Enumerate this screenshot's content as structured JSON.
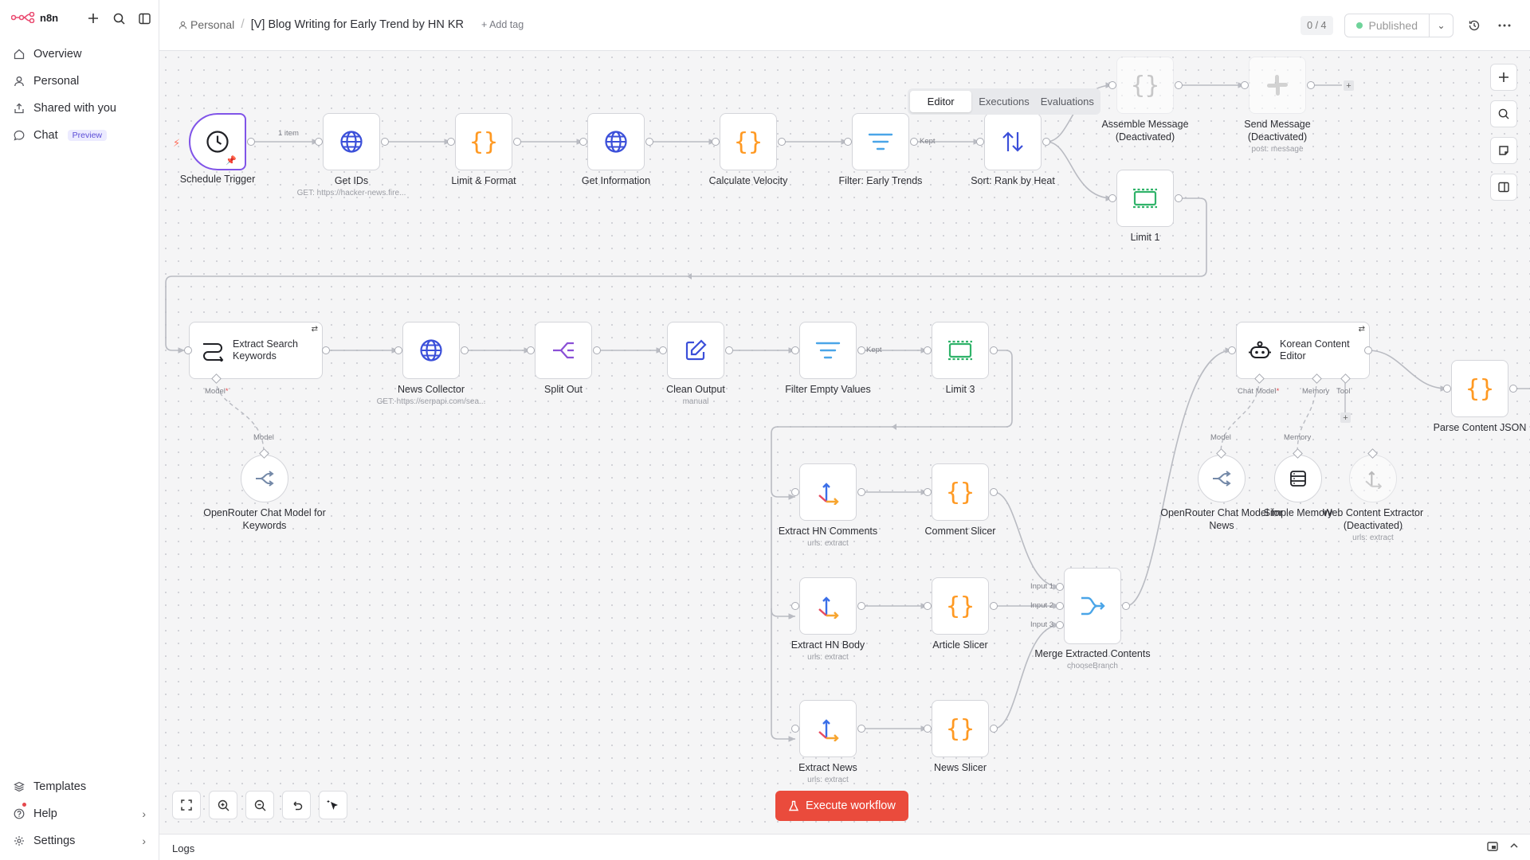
{
  "sidebar": {
    "brand": "n8n",
    "items": [
      {
        "label": "Overview",
        "icon": "home-icon"
      },
      {
        "label": "Personal",
        "icon": "user-icon"
      },
      {
        "label": "Shared with you",
        "icon": "share-icon"
      },
      {
        "label": "Chat",
        "icon": "chat-icon",
        "badge": "Preview"
      }
    ],
    "bottom": [
      {
        "label": "Templates",
        "icon": "templates-icon"
      },
      {
        "label": "Help",
        "icon": "help-icon"
      },
      {
        "label": "Settings",
        "icon": "settings-icon"
      }
    ]
  },
  "header": {
    "breadcrumb_personal": "Personal",
    "workflow_title": "[V] Blog Writing for Early Trend by HN KR",
    "add_tag": "+ Add tag",
    "counter": "0 / 4",
    "publish_status": "Published"
  },
  "tabs": [
    "Editor",
    "Executions",
    "Evaluations"
  ],
  "nodes": {
    "schedule_trigger": {
      "label": "Schedule Trigger"
    },
    "get_ids": {
      "label": "Get IDs",
      "sub": "GET: https://hacker-news.fire..."
    },
    "limit_format": {
      "label": "Limit & Format"
    },
    "get_information": {
      "label": "Get Information"
    },
    "calculate_velocity": {
      "label": "Calculate Velocity"
    },
    "filter_early": {
      "label": "Filter: Early Trends"
    },
    "sort_rank": {
      "label": "Sort: Rank by Heat"
    },
    "assemble_message": {
      "label": "Assemble Message (Deactivated)"
    },
    "send_message": {
      "label": "Send Message (Deactivated)",
      "sub": "post: message"
    },
    "limit_1": {
      "label": "Limit 1"
    },
    "extract_keywords": {
      "label": "Extract Search Keywords"
    },
    "news_collector": {
      "label": "News Collector",
      "sub": "GET: https://serpapi.com/sea..."
    },
    "split_out": {
      "label": "Split Out"
    },
    "clean_output": {
      "label": "Clean Output",
      "sub": "manual"
    },
    "filter_empty": {
      "label": "Filter Empty Values"
    },
    "limit_3": {
      "label": "Limit 3"
    },
    "openrouter_keywords": {
      "label": "OpenRouter Chat Model for Keywords"
    },
    "extract_hn_comments": {
      "label": "Extract HN Comments",
      "sub": "urls: extract"
    },
    "comment_slicer": {
      "label": "Comment Slicer"
    },
    "extract_hn_body": {
      "label": "Extract HN Body",
      "sub": "urls: extract"
    },
    "article_slicer": {
      "label": "Article Slicer"
    },
    "extract_news": {
      "label": "Extract News",
      "sub": "urls: extract"
    },
    "news_slicer": {
      "label": "News Slicer"
    },
    "merge_contents": {
      "label": "Merge Extracted Contents",
      "sub": "chooseBranch"
    },
    "korean_editor": {
      "label": "Korean Content Editor"
    },
    "openrouter_news": {
      "label": "OpenRouter Chat Model for News"
    },
    "simple_memory": {
      "label": "Simple Memory"
    },
    "web_extractor": {
      "label": "Web Content Extractor (Deactivated)",
      "sub": "urls: extract"
    },
    "parse_json": {
      "label": "Parse Content JSON"
    }
  },
  "edge_labels": {
    "one_item": "1 item",
    "kept1": "Kept",
    "kept2": "Kept",
    "model": "Model",
    "model_in": "Model",
    "chat_model": "Chat Model",
    "memory": "Memory",
    "tool": "Tool",
    "model_in2": "Model",
    "memory_in": "Memory",
    "input1": "Input 1",
    "input2": "Input 2",
    "input3": "Input 3"
  },
  "execute_button": "Execute workflow",
  "logs_label": "Logs",
  "colors": {
    "accent": "#ea4b3c",
    "brand": "#ea4b71",
    "code": "#ff9922",
    "http": "#3b4fd9",
    "filter": "#4aa5e8",
    "limit": "#30b36a",
    "trigger_border": "#8054e8"
  }
}
